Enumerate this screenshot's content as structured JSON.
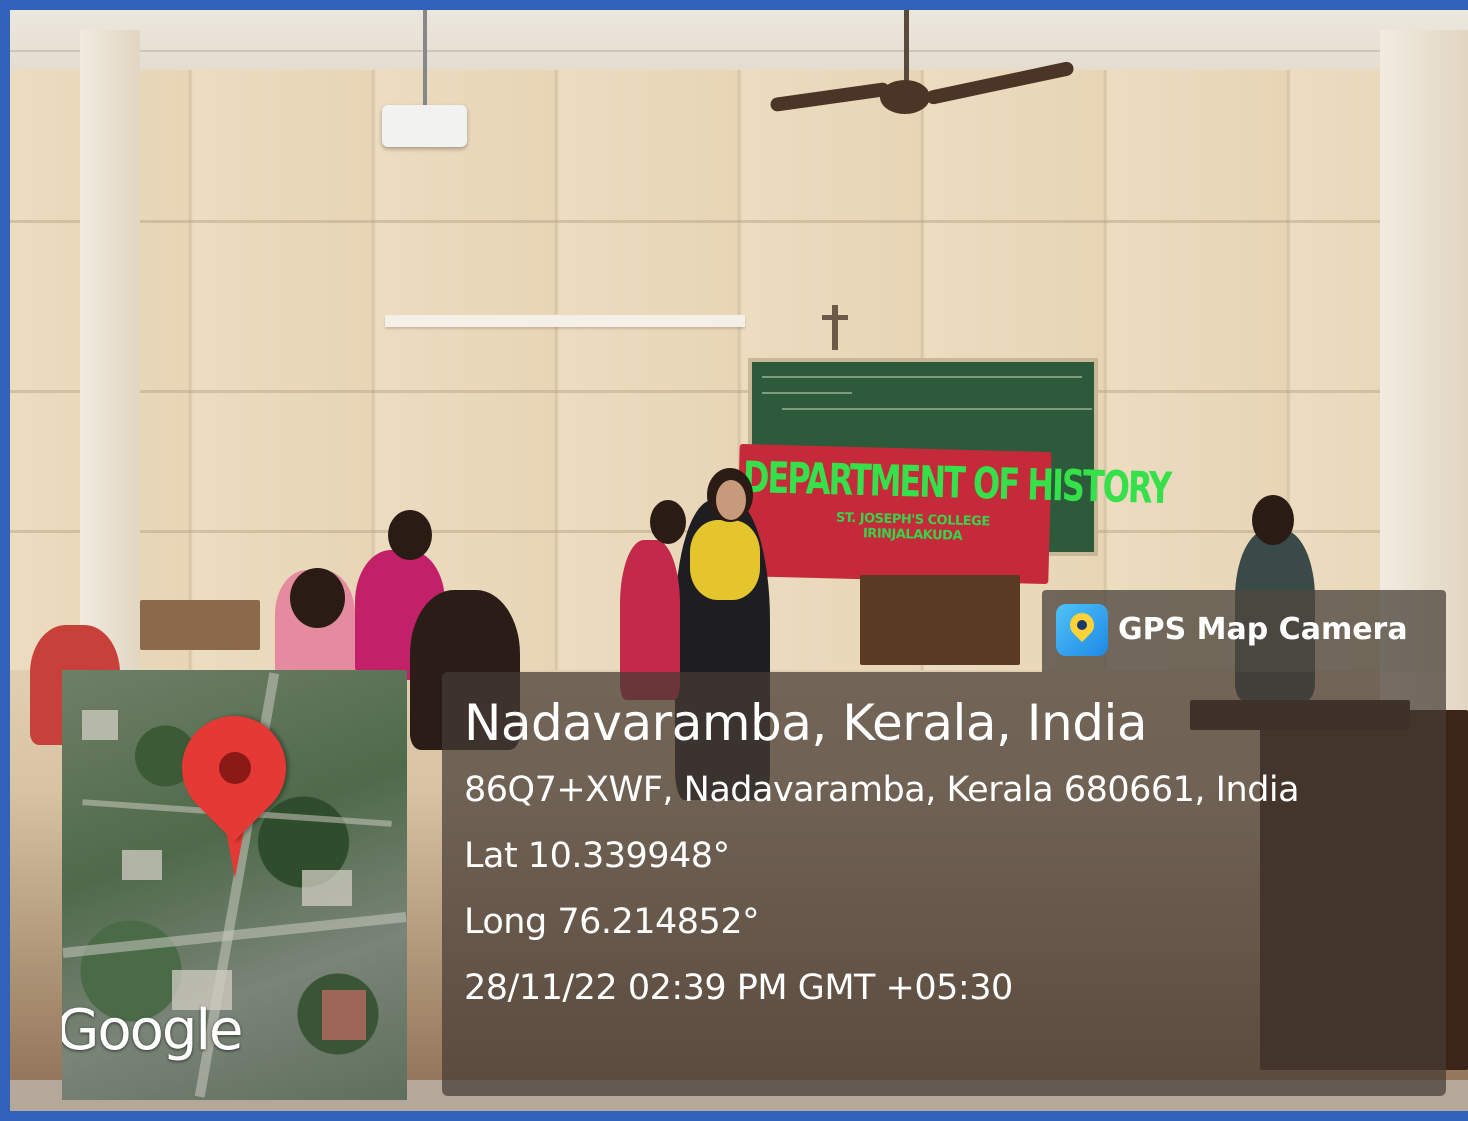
{
  "banner": {
    "title": "DEPARTMENT OF HISTORY",
    "subtitle": "ST. JOSEPH'S COLLEGE IRINJALAKUDA"
  },
  "overlay": {
    "app_name": "GPS Map Camera",
    "app_icon": "gps-map-camera-icon",
    "location_title": "Nadavaramba, Kerala, India",
    "address": "86Q7+XWF, Nadavaramba, Kerala 680661, India",
    "latitude": "Lat 10.339948°",
    "longitude": "Long 76.214852°",
    "timestamp": "28/11/22 02:39 PM GMT +05:30"
  },
  "map": {
    "provider_label": "Google",
    "pin_icon": "map-pin-icon",
    "pin_color": "#e53935"
  },
  "colors": {
    "frame": "#2f62b8",
    "banner_bg": "#c52a3a",
    "banner_text": "#35e04a"
  }
}
